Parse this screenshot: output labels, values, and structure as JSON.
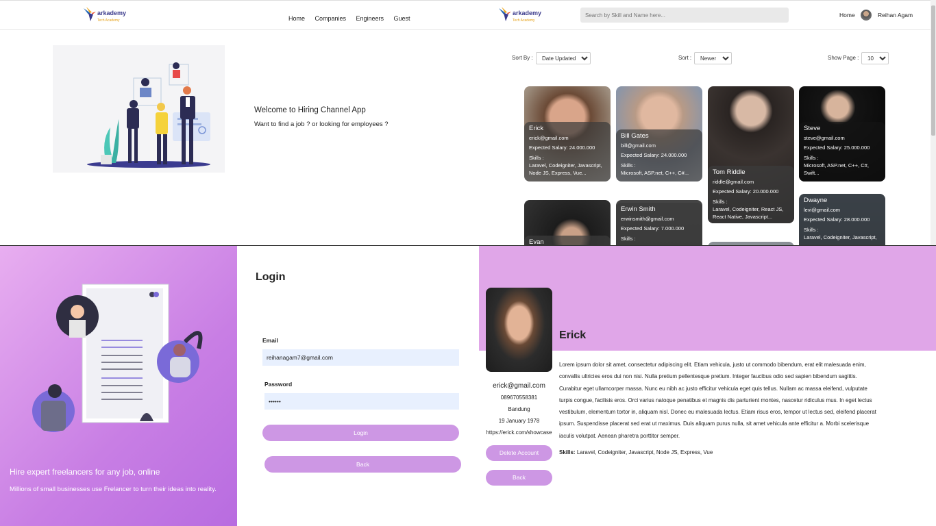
{
  "left_nav": {
    "logo_word": "arkademy",
    "logo_sub": "Tech Academy",
    "links": [
      "Home",
      "Companies",
      "Engineers",
      "Guest"
    ]
  },
  "hero": {
    "title": "Welcome to Hiring Channel App",
    "subtitle": "Want to find a job ? or looking for employees ?"
  },
  "right_nav": {
    "logo_word": "arkademy",
    "logo_sub": "Tech Academy",
    "search_placeholder": "Search by Skill and Name here...",
    "home": "Home",
    "user_name": "Reihan Agam"
  },
  "filters": {
    "sort_by_label": "Sort By :",
    "sort_by_value": "Date Updated",
    "sort_label": "Sort :",
    "sort_value": "Newer",
    "show_page_label": "Show Page :",
    "show_page_value": "10"
  },
  "cards": [
    {
      "name": "Erick",
      "email": "erick@gmail.com",
      "salary": "Expected Salary:  24.000.000",
      "skills_label": "Skills :",
      "skills": "Laravel, Codeigniter, Javascript, Node JS, Express, Vue..."
    },
    {
      "name": "Bill Gates",
      "email": "bill@gmail.com",
      "salary": "Expected Salary:  24.000.000",
      "skills_label": "Skills :",
      "skills": "Microsoft, ASP.net, C++, C#..."
    },
    {
      "name": "Tom Riddle",
      "email": "riddle@gmail.com",
      "salary": "Expected Salary:  20.000.000",
      "skills_label": "Skills :",
      "skills": "Laravel, Codeigniter, React JS, React Native, Javascript..."
    },
    {
      "name": "Steve",
      "email": "steve@gmail.com",
      "salary": "Expected Salary:  25.000.000",
      "skills_label": "Skills :",
      "skills": "Microsoft, ASP.net, C++, C#, Swift..."
    },
    {
      "name": "Evan",
      "email": "",
      "salary": "",
      "skills_label": "",
      "skills": ""
    },
    {
      "name": "Erwin Smith",
      "email": "erwinsmith@gmail.com",
      "salary": "Expected Salary:  7.000.000",
      "skills_label": "Skills :",
      "skills": ""
    },
    {
      "name": "Dwayne",
      "email": "levi@gmail.com",
      "salary": "Expected Salary:  28.000.000",
      "skills_label": "Skills :",
      "skills": "Laravel, Codeigniter, Javascript,"
    }
  ],
  "login_left": {
    "headline": "Hire expert freelancers for any job, online",
    "sub": "Millions of small businesses use Frelancer to turn their ideas into reality."
  },
  "login": {
    "title": "Login",
    "email_label": "Email",
    "email_value": "reihanagam7@gmail.com",
    "password_label": "Password",
    "password_value": "••••••",
    "login_button": "Login",
    "back_button": "Back"
  },
  "profile": {
    "name": "Erick",
    "email": "erick@gmail.com",
    "phone": "089670558381",
    "city": "Bandung",
    "birth": "19 January 1978",
    "website": "https://erick.com/showcase",
    "delete_button": "Delete Account",
    "back_button": "Back",
    "description": "Lorem ipsum dolor sit amet, consectetur adipiscing elit. Etiam vehicula, justo ut commodo bibendum, erat elit malesuada enim, convallis ultricies eros dui non nisi. Nulla pretium pellentesque pretium. Integer faucibus odio sed sapien bibendum sagittis. Curabitur eget ullamcorper massa. Nunc eu nibh ac justo efficitur vehicula eget quis tellus. Nullam ac massa eleifend, vulputate turpis congue, facilisis eros. Orci varius natoque penatibus et magnis dis parturient montes, nascetur ridiculus mus. In eget lectus vestibulum, elementum tortor in, aliquam nisl. Donec eu malesuada lectus. Etiam risus eros, tempor ut lectus sed, eleifend placerat ipsum. Suspendisse placerat sed erat ut maximus. Duis aliquam purus nulla, sit amet vehicula ante efficitur a. Morbi scelerisque iaculis volutpat. Aenean pharetra porttitor semper.",
    "skills_label": "Skills:",
    "skills": "Laravel, Codeigniter, Javascript, Node JS, Express, Vue"
  },
  "colors": {
    "accent_purple": "#cd97e4",
    "profile_band": "#e0a6e8",
    "nav_text": "#222222"
  }
}
